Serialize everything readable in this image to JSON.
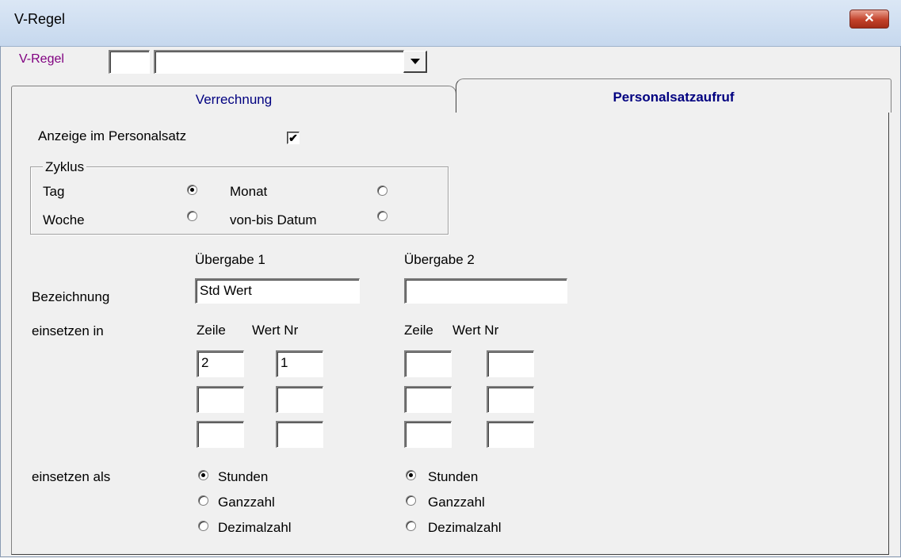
{
  "window": {
    "title": "V-Regel",
    "close_glyph": "✕"
  },
  "vregel": {
    "label": "V-Regel",
    "code_value": "",
    "name_value": ""
  },
  "tabs": [
    {
      "label": "Verrechnung",
      "active": false
    },
    {
      "label": "Personalsatzaufruf",
      "active": true
    }
  ],
  "anzeige": {
    "label": "Anzeige im Personalsatz",
    "checked": true,
    "check_glyph": "✔"
  },
  "zyklus": {
    "title": "Zyklus",
    "options": [
      {
        "label": "Tag",
        "selected": true
      },
      {
        "label": "Monat",
        "selected": false
      },
      {
        "label": "Woche",
        "selected": false
      },
      {
        "label": "von-bis Datum",
        "selected": false
      }
    ]
  },
  "uebergabe": {
    "bezeichnung_label": "Bezeichnung",
    "einsetzen_in_label": "einsetzen in",
    "einsetzen_als_label": "einsetzen als",
    "columns": [
      {
        "header": "Übergabe 1",
        "bezeichnung": "Std Wert",
        "zeile_label": "Zeile",
        "wertnr_label": "Wert Nr",
        "zeile": [
          "2",
          "",
          ""
        ],
        "wertnr": [
          "1",
          "",
          ""
        ],
        "als_options": [
          "Stunden",
          "Ganzzahl",
          "Dezimalzahl"
        ],
        "als_selected": 0
      },
      {
        "header": "Übergabe 2",
        "bezeichnung": "",
        "zeile_label": "Zeile",
        "wertnr_label": "Wert Nr",
        "zeile": [
          "",
          "",
          ""
        ],
        "wertnr": [
          "",
          "",
          ""
        ],
        "als_options": [
          "Stunden",
          "Ganzzahl",
          "Dezimalzahl"
        ],
        "als_selected": 0
      }
    ]
  }
}
